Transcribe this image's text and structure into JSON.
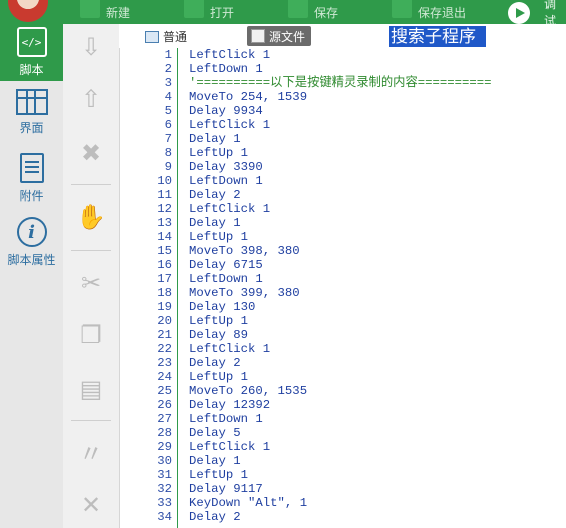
{
  "toolbar": {
    "items": [
      {
        "label": "新建",
        "icon": "plus-icon"
      },
      {
        "label": "打开",
        "icon": "folder-icon"
      },
      {
        "label": "保存",
        "icon": "save-icon"
      },
      {
        "label": "保存退出",
        "icon": "save-exit-icon"
      },
      {
        "label": "调试",
        "icon": "play-icon"
      }
    ],
    "color": "#2f9a4a"
  },
  "sidebar": {
    "items": [
      {
        "label": "脚本",
        "icon": "script-icon",
        "active": true
      },
      {
        "label": "界面",
        "icon": "grid-icon"
      },
      {
        "label": "附件",
        "icon": "attachment-icon"
      },
      {
        "label": "脚本属性",
        "icon": "info-icon"
      }
    ]
  },
  "tools": [
    "arrow-down-icon",
    "arrow-up-icon",
    "delete-icon",
    "hand-icon",
    "cut-icon",
    "copy-icon",
    "paste-icon",
    "comment-icon",
    "uncomment-icon"
  ],
  "editor": {
    "tabs": [
      {
        "label": "普通",
        "active": false
      },
      {
        "label": "源文件",
        "active": true
      }
    ],
    "search_text": "搜索子程序"
  },
  "code_lines": [
    {
      "n": "1",
      "t": "LeftClick 1"
    },
    {
      "n": "2",
      "t": "LeftDown 1"
    },
    {
      "n": "3",
      "t": "'==========以下是按键精灵录制的内容==========",
      "comment": true
    },
    {
      "n": "4",
      "t": "MoveTo 254, 1539"
    },
    {
      "n": "5",
      "t": "Delay 9934"
    },
    {
      "n": "6",
      "t": "LeftClick 1"
    },
    {
      "n": "7",
      "t": "Delay 1"
    },
    {
      "n": "8",
      "t": "LeftUp 1"
    },
    {
      "n": "9",
      "t": "Delay 3390"
    },
    {
      "n": "10",
      "t": "LeftDown 1"
    },
    {
      "n": "11",
      "t": "Delay 2"
    },
    {
      "n": "12",
      "t": "LeftClick 1"
    },
    {
      "n": "13",
      "t": "Delay 1"
    },
    {
      "n": "14",
      "t": "LeftUp 1"
    },
    {
      "n": "15",
      "t": "MoveTo 398, 380"
    },
    {
      "n": "16",
      "t": "Delay 6715"
    },
    {
      "n": "17",
      "t": "LeftDown 1"
    },
    {
      "n": "18",
      "t": "MoveTo 399, 380"
    },
    {
      "n": "19",
      "t": "Delay 130"
    },
    {
      "n": "20",
      "t": "LeftUp 1"
    },
    {
      "n": "21",
      "t": "Delay 89"
    },
    {
      "n": "22",
      "t": "LeftClick 1"
    },
    {
      "n": "23",
      "t": "Delay 2"
    },
    {
      "n": "24",
      "t": "LeftUp 1"
    },
    {
      "n": "25",
      "t": "MoveTo 260, 1535"
    },
    {
      "n": "26",
      "t": "Delay 12392"
    },
    {
      "n": "27",
      "t": "LeftDown 1"
    },
    {
      "n": "28",
      "t": "Delay 5"
    },
    {
      "n": "29",
      "t": "LeftClick 1"
    },
    {
      "n": "30",
      "t": "Delay 1"
    },
    {
      "n": "31",
      "t": "LeftUp 1"
    },
    {
      "n": "32",
      "t": "Delay 9117"
    },
    {
      "n": "33",
      "t": "KeyDown \"Alt\", 1"
    },
    {
      "n": "34",
      "t": "Delay 2"
    }
  ]
}
